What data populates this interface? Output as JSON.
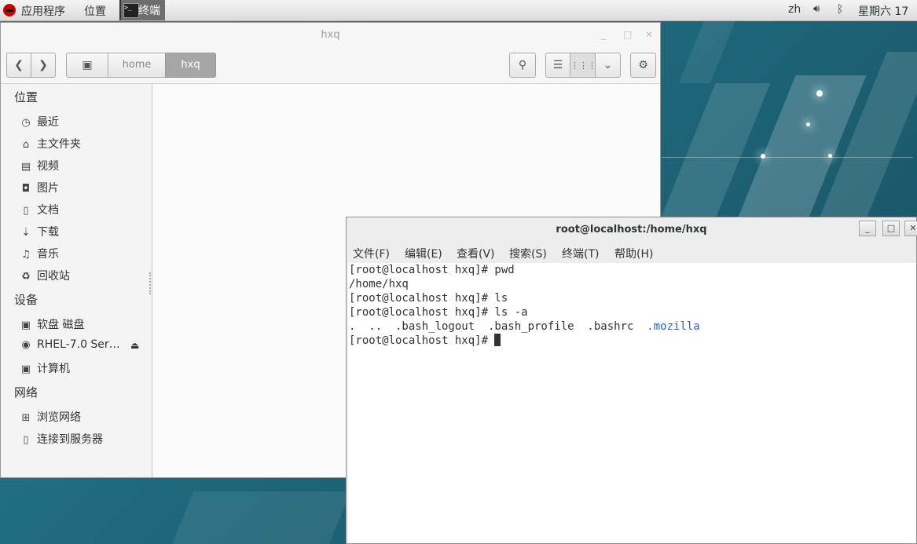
{
  "topbar": {
    "apps_label": "应用程序",
    "places_label": "位置",
    "terminal_task_label": "终端",
    "terminal_task_icon_text": ">_",
    "lang": "zh",
    "clock": "星期六 17"
  },
  "file_manager": {
    "title": "hxq",
    "breadcrumb": [
      "home",
      "hxq"
    ],
    "sidebar": {
      "section_places": "位置",
      "places": [
        {
          "icon": "clock-icon",
          "label": "最近"
        },
        {
          "icon": "home-icon",
          "label": "主文件夹"
        },
        {
          "icon": "film-icon",
          "label": "视频"
        },
        {
          "icon": "camera-icon",
          "label": "图片"
        },
        {
          "icon": "document-icon",
          "label": "文档"
        },
        {
          "icon": "download-icon",
          "label": "下载"
        },
        {
          "icon": "music-icon",
          "label": "音乐"
        },
        {
          "icon": "trash-icon",
          "label": "回收站"
        }
      ],
      "section_devices": "设备",
      "devices": [
        {
          "icon": "floppy-icon",
          "label": "软盘 磁盘"
        },
        {
          "icon": "disc-icon",
          "label": "RHEL-7.0 Ser…"
        },
        {
          "icon": "computer-icon",
          "label": "计算机"
        }
      ],
      "section_network": "网络",
      "network": [
        {
          "icon": "network-icon",
          "label": "浏览网络"
        },
        {
          "icon": "server-icon",
          "label": "连接到服务器"
        }
      ]
    }
  },
  "terminal": {
    "title": "root@localhost:/home/hxq",
    "menu": [
      "文件(F)",
      "编辑(E)",
      "查看(V)",
      "搜索(S)",
      "终端(T)",
      "帮助(H)"
    ],
    "lines": [
      "[root@localhost hxq]# pwd",
      "/home/hxq",
      "[root@localhost hxq]# ls",
      "[root@localhost hxq]# ls -a"
    ],
    "ls_output_plain": ".  ..  .bash_logout  .bash_profile  .bashrc  ",
    "ls_output_dir": ".mozilla",
    "prompt": "[root@localhost hxq]# "
  },
  "colors": {
    "desktop": "#1f6a7f",
    "directory_text": "#2a66bb",
    "breadcrumb_active": "#a6a6a6"
  }
}
